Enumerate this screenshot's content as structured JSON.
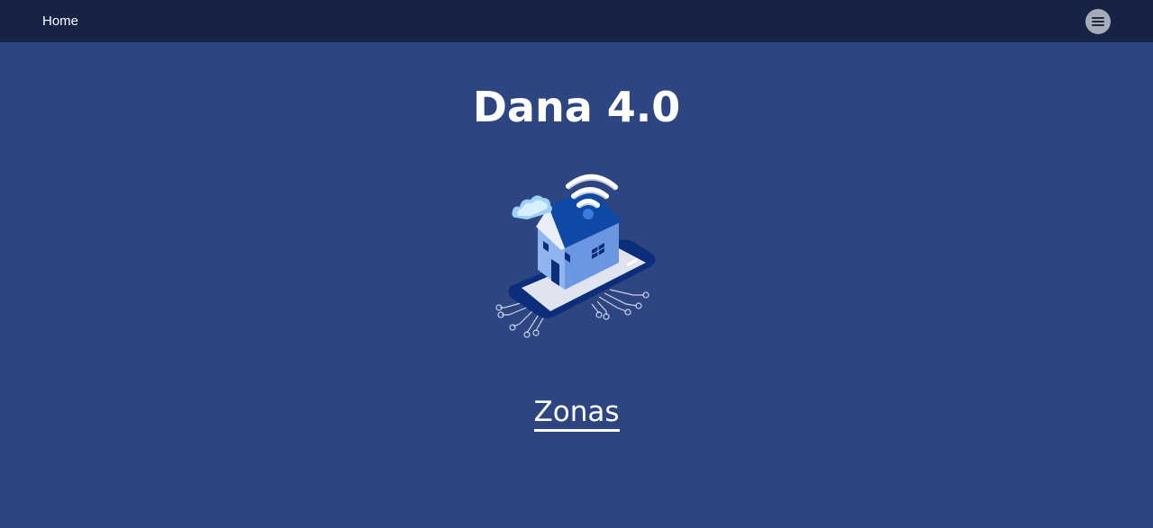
{
  "navbar": {
    "home_label": "Home",
    "menu_icon": "hamburger-menu-icon"
  },
  "main": {
    "title": "Dana 4.0",
    "illustration_icon": "smart-home-icon",
    "zonas_link": "Zonas"
  },
  "colors": {
    "background": "#2d4682",
    "navbar": "#172345",
    "text": "#ffffff",
    "menu_button": "#a7abb8"
  }
}
